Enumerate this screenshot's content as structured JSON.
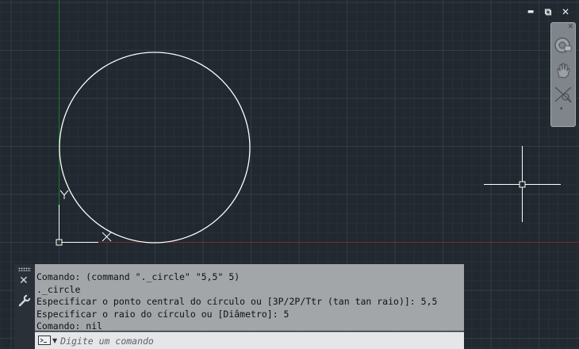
{
  "window_controls": {
    "minimize": "▬",
    "restore": "⧉",
    "close": "✕"
  },
  "navbar": {
    "close_glyph": "✕",
    "arrow_glyph": "▾",
    "icons": [
      "steering-wheel-icon",
      "pan-hand-icon",
      "zoom-extents-icon"
    ]
  },
  "drawing": {
    "ucs": {
      "y_label": "Y",
      "x_label": "X"
    },
    "circle": {
      "center": [
        5,
        5
      ],
      "radius": 5
    }
  },
  "command_line": {
    "history": [
      "Comando: (command \"._circle\" \"5,5\" 5)",
      "._circle",
      "Especificar o ponto central do círculo ou [3P/2P/Ttr (tan tan raio)]: 5,5",
      "Especificar o raio do círculo ou [Diâmetro]: 5",
      "Comando: nil"
    ],
    "placeholder": "Digite um comando",
    "close_glyph": "✕"
  },
  "colors": {
    "background": "#212830",
    "grid_minor": "#262d36",
    "grid_major": "#2f3742",
    "y_axis": "#1f7a2e",
    "x_axis": "#7a2a2a",
    "geometry": "#ffffff"
  }
}
